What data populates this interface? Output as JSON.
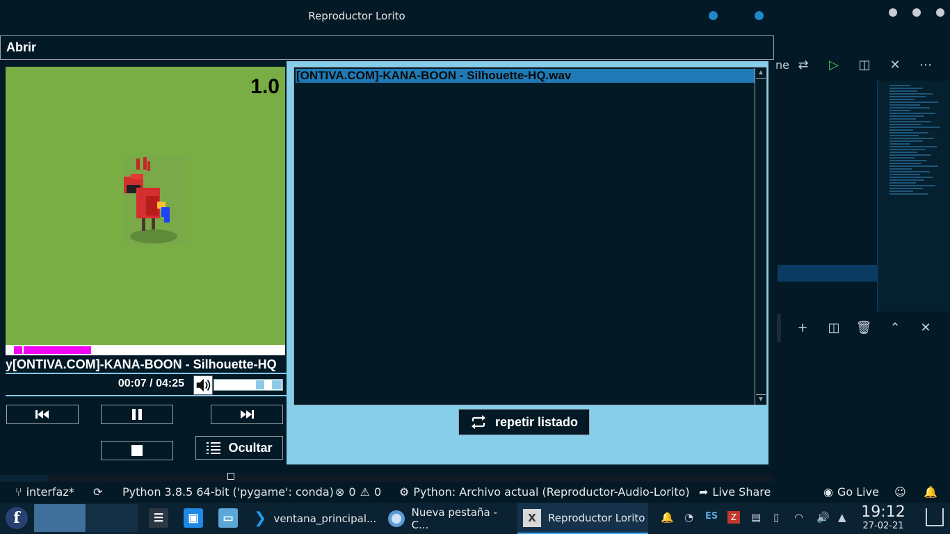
{
  "window": {
    "title": "Reproductor Lorito",
    "menu_abrir": "Abrir"
  },
  "player": {
    "speed": "1.0",
    "now_playing": "y[ONTIVA.COM]-KANA-BOON - Silhouette-HQ",
    "time": "00:07 / 04:25",
    "progress_fraction": 0.027,
    "volume_fraction": 0.85,
    "hide_label": "Ocultar"
  },
  "playlist": {
    "items": [
      "[ONTIVA.COM]-KANA-BOON - Silhouette-HQ.wav"
    ],
    "repeat_label": "repetir listado"
  },
  "vscode": {
    "toolbar_fragment": "ne"
  },
  "statusbar": {
    "branch": "interfaz*",
    "python": "Python 3.8.5 64-bit ('pygame': conda)",
    "errors": "0",
    "warnings": "0",
    "run_config": "Python: Archivo actual (Reproductor-Audio-Lorito)",
    "live_share": "Live Share",
    "go_live": "Go Live"
  },
  "taskbar": {
    "tasks": [
      "ventana_principal...",
      "Nueva pestaña - C...",
      "Reproductor Lorito"
    ],
    "lang": "ES",
    "time": "19:12",
    "date": "27-02-21"
  },
  "colors": {
    "accent": "#87ceeb",
    "art_bg": "#78ae44",
    "selection": "#1f7ab5",
    "progress": "#f007f0"
  }
}
